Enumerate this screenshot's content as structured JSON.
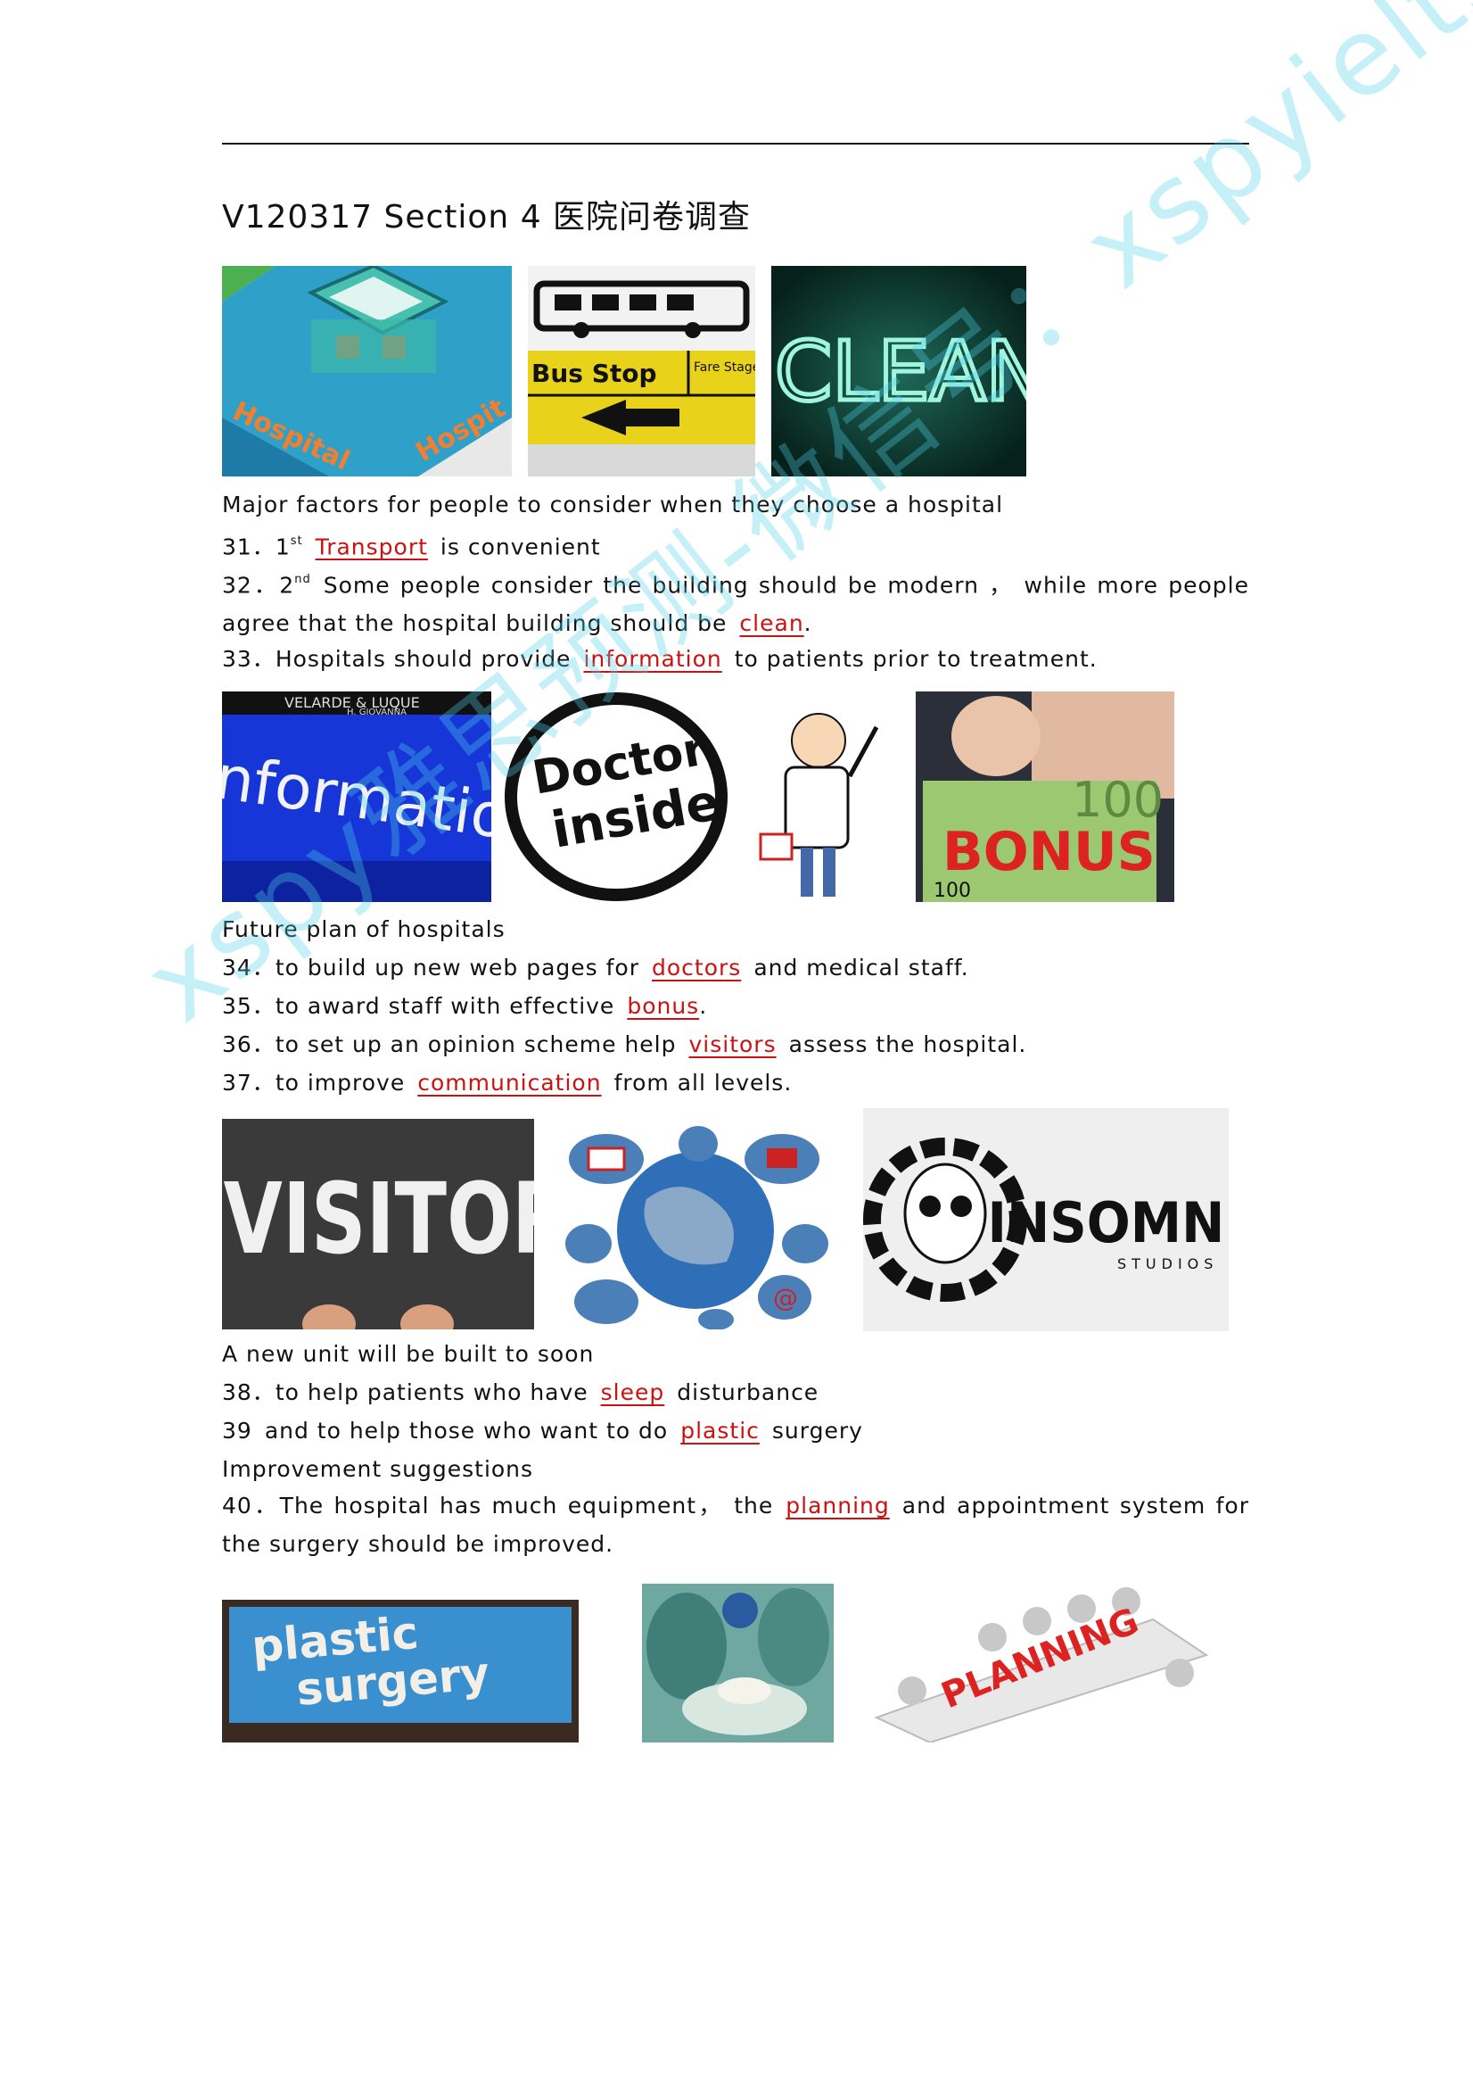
{
  "doc": {
    "title": "V120317  Section  4  医院问卷调查",
    "watermark": "xspy雅思预测-微信号：xspyielts"
  },
  "section1": {
    "heading": "Major  factors  for  people  to  consider  when  they  choose  a  hospital",
    "q31": {
      "num": "31．",
      "ord": "1",
      "sup": "st",
      "answer": "Transport",
      "after": "is  convenient"
    },
    "q32": {
      "num": "32．2",
      "sup": "nd",
      "before": "Some  people  consider  the  building  should  be  modern ，  while  more  people  agree  that  the  hospital  building  should  be",
      "answer": "clean",
      "after": "."
    },
    "q33": {
      "num": "33．",
      "before": "Hospitals  should  provide",
      "answer": "information",
      "after": "to  patients  prior  to  treatment."
    }
  },
  "section2": {
    "heading": "Future  plan  of  hospitals",
    "q34": {
      "num": "34．",
      "before": "to  build  up  new  web  pages  for",
      "answer": "doctors",
      "after": "and  medical  staff."
    },
    "q35": {
      "num": "35．",
      "before": "to  award  staff  with  effective",
      "answer": "bonus",
      "after": "."
    },
    "q36": {
      "num": "36．",
      "before": "to  set  up  an  opinion  scheme  help",
      "answer": "visitors",
      "after": "assess  the  hospital."
    },
    "q37": {
      "num": "37．",
      "before": "to  improve",
      "answer": "communication",
      "after": "from  all  levels."
    }
  },
  "section3": {
    "heading": "A  new  unit  will  be  built  to  soon",
    "q38": {
      "num": "38．",
      "before": "to  help  patients  who  have",
      "answer": "sleep",
      "after": "disturbance"
    },
    "q39": {
      "num": "39",
      "before": "and  to  help  those  who  want  to  do",
      "answer": "plastic",
      "after": "surgery"
    }
  },
  "section4": {
    "heading": "Improvement  suggestions",
    "q40": {
      "num": "40．",
      "before": "The hospital has much equipment，  the",
      "answer": "planning",
      "after": "and appointment system for the surgery should  be  improved."
    }
  },
  "image_text": {
    "hospital": "Hospital",
    "hospital2": "Hospit",
    "bus_stop": "Bus Stop",
    "fare_stage": "Fare Stage",
    "clean": "CLEAN",
    "information": "nformation",
    "info_banner": "VELARDE & LUQUE",
    "info_banner2": "H. GIOVANNA",
    "doctor_inside": "Doctor",
    "doctor_inside2": "inside",
    "bonus": "BONUS",
    "bonus_num": "100",
    "euro": "100",
    "visitor": "VISITOR",
    "insomnia": "INSOMNIA",
    "studios": "STUDIOS",
    "plastic": "plastic",
    "surgery": "surgery",
    "planning": "PLANNING"
  },
  "colors": {
    "answer": "#cc1111",
    "watermark": "#50d2eb"
  }
}
